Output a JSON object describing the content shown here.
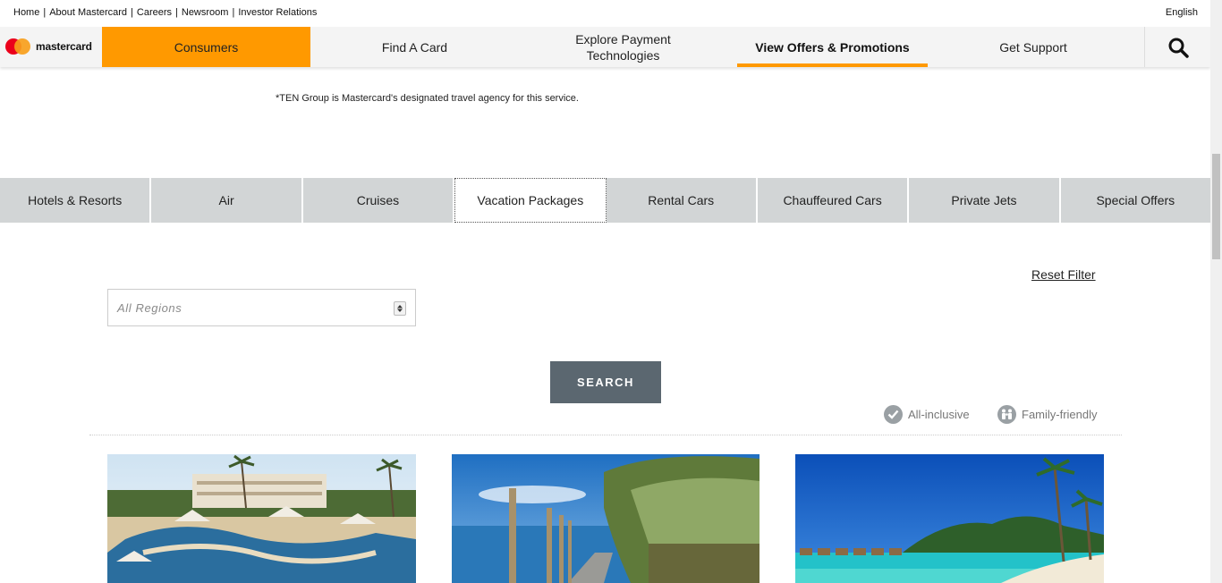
{
  "utility": {
    "links": [
      "Home",
      "About Mastercard",
      "Careers",
      "Newsroom",
      "Investor Relations"
    ],
    "separator": "|",
    "language": "English"
  },
  "brand": {
    "wordmark": "mastercard"
  },
  "nav": {
    "consumers": "Consumers",
    "find_card": "Find A Card",
    "explore_line1": "Explore Payment",
    "explore_line2": "Technologies",
    "offers": "View Offers & Promotions",
    "support": "Get Support",
    "search_icon": "search-icon"
  },
  "disclaimer": "*TEN Group is Mastercard's designated travel agency for this service.",
  "tabs": [
    "Hotels & Resorts",
    "Air",
    "Cruises",
    "Vacation Packages",
    "Rental Cars",
    "Chauffeured Cars",
    "Private Jets",
    "Special Offers"
  ],
  "filter": {
    "reset": "Reset Filter",
    "region_placeholder": "All Regions",
    "search_label": "SEARCH"
  },
  "legend": {
    "all_inclusive": "All-inclusive",
    "family_friendly": "Family-friendly"
  },
  "colors": {
    "accent": "#ff9900",
    "tab_bg": "#d2d5d6",
    "button": "#5b6770"
  }
}
